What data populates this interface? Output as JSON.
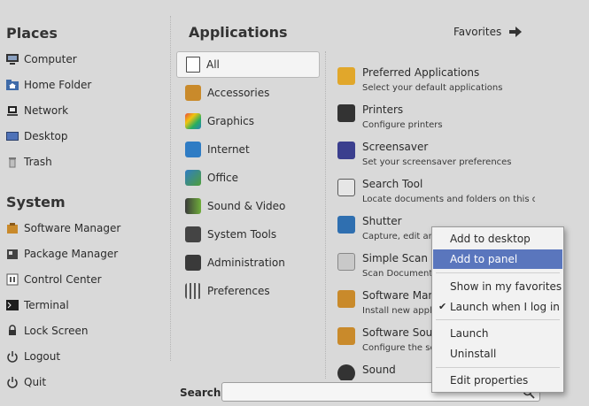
{
  "places": {
    "title": "Places",
    "items": [
      {
        "label": "Computer",
        "icon": "computer-icon"
      },
      {
        "label": "Home Folder",
        "icon": "home-folder-icon"
      },
      {
        "label": "Network",
        "icon": "network-icon"
      },
      {
        "label": "Desktop",
        "icon": "desktop-icon"
      },
      {
        "label": "Trash",
        "icon": "trash-icon"
      }
    ]
  },
  "system": {
    "title": "System",
    "items": [
      {
        "label": "Software Manager",
        "icon": "software-manager-icon"
      },
      {
        "label": "Package Manager",
        "icon": "package-manager-icon"
      },
      {
        "label": "Control Center",
        "icon": "control-center-icon"
      },
      {
        "label": "Terminal",
        "icon": "terminal-icon"
      },
      {
        "label": "Lock Screen",
        "icon": "lock-icon"
      },
      {
        "label": "Logout",
        "icon": "logout-icon"
      },
      {
        "label": "Quit",
        "icon": "power-icon"
      }
    ]
  },
  "applications": {
    "title": "Applications",
    "favorites_label": "Favorites",
    "categories": [
      {
        "label": "All",
        "color": "#4a4a4a"
      },
      {
        "label": "Accessories",
        "color": "#c98a2b"
      },
      {
        "label": "Graphics",
        "color": "#c0392b"
      },
      {
        "label": "Internet",
        "color": "#2f7cc4"
      },
      {
        "label": "Office",
        "color": "#4f9f3a"
      },
      {
        "label": "Sound & Video",
        "color": "#3a3a3a"
      },
      {
        "label": "System Tools",
        "color": "#444444"
      },
      {
        "label": "Administration",
        "color": "#3a3a3a"
      },
      {
        "label": "Preferences",
        "color": "#555555"
      }
    ],
    "selected_category": "All",
    "apps": [
      {
        "name": "Preferred Applications",
        "desc": "Select your default applications",
        "color": "#e1a72b"
      },
      {
        "name": "Printers",
        "desc": "Configure printers",
        "color": "#333333"
      },
      {
        "name": "Screensaver",
        "desc": "Set your screensaver preferences",
        "color": "#3b3f8e"
      },
      {
        "name": "Search Tool",
        "desc": "Locate documents and folders on this c...",
        "color": "#5a5a5a"
      },
      {
        "name": "Shutter",
        "desc": "Capture, edit and",
        "color": "#2f6fb0"
      },
      {
        "name": "Simple Scan",
        "desc": "Scan Documents",
        "color": "#9a9a9a"
      },
      {
        "name": "Software Mana",
        "desc": "Install new applic",
        "color": "#c98a2b"
      },
      {
        "name": "Software Sourc",
        "desc": "Configure the sou",
        "color": "#c98a2b"
      },
      {
        "name": "Sound",
        "desc": "",
        "color": "#333333"
      }
    ]
  },
  "search": {
    "label": "Search:",
    "value": ""
  },
  "context_menu": {
    "items": [
      "Add to desktop",
      "Add to panel",
      "Show in my favorites",
      "Launch when I log in",
      "Launch",
      "Uninstall",
      "Edit properties"
    ],
    "highlighted": "Add to panel",
    "checked": "Launch when I log in",
    "highlight_color": "#5a76bd"
  }
}
